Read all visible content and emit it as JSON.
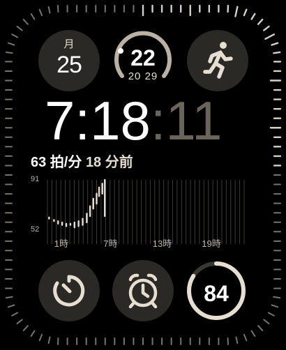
{
  "date": {
    "month": "月",
    "day": "25"
  },
  "weather": {
    "current": "22",
    "low": "20",
    "high": "29"
  },
  "workout": {
    "icon": "running-figure-icon"
  },
  "time": {
    "hour": "7",
    "minute": "18",
    "second": "11"
  },
  "heart_rate": {
    "value": "63",
    "unit": "拍/分",
    "ago_value": "18",
    "ago_unit": "分前"
  },
  "chart_data": {
    "type": "bar",
    "title": "",
    "ylabels": [
      "91",
      "52"
    ],
    "ylim": [
      52,
      91
    ],
    "xticks": [
      "1時",
      "7時",
      "13時",
      "19時"
    ],
    "xtick_hours": [
      1,
      7,
      13,
      19
    ],
    "hours": 24,
    "series": [
      {
        "values": [
          [
            0.2,
            60,
            61
          ],
          [
            0.8,
            58,
            59
          ],
          [
            1.3,
            56,
            58
          ],
          [
            1.8,
            55,
            57
          ],
          [
            2.3,
            54,
            56
          ],
          [
            2.8,
            55,
            56
          ],
          [
            3.3,
            53,
            57
          ],
          [
            3.8,
            54,
            58
          ],
          [
            4.3,
            55,
            60
          ],
          [
            4.8,
            57,
            64
          ],
          [
            5.2,
            62,
            70
          ],
          [
            5.6,
            68,
            76
          ],
          [
            6.0,
            72,
            80
          ],
          [
            6.3,
            78,
            85
          ],
          [
            6.7,
            80,
            88
          ],
          [
            7.0,
            62,
            91
          ]
        ]
      }
    ]
  },
  "activity": {
    "value": "84"
  },
  "colors": {
    "tick": "#7a7467",
    "accent": "#e6dfd1",
    "dim": "#6b645a",
    "complication_bg": "#2b2925"
  }
}
